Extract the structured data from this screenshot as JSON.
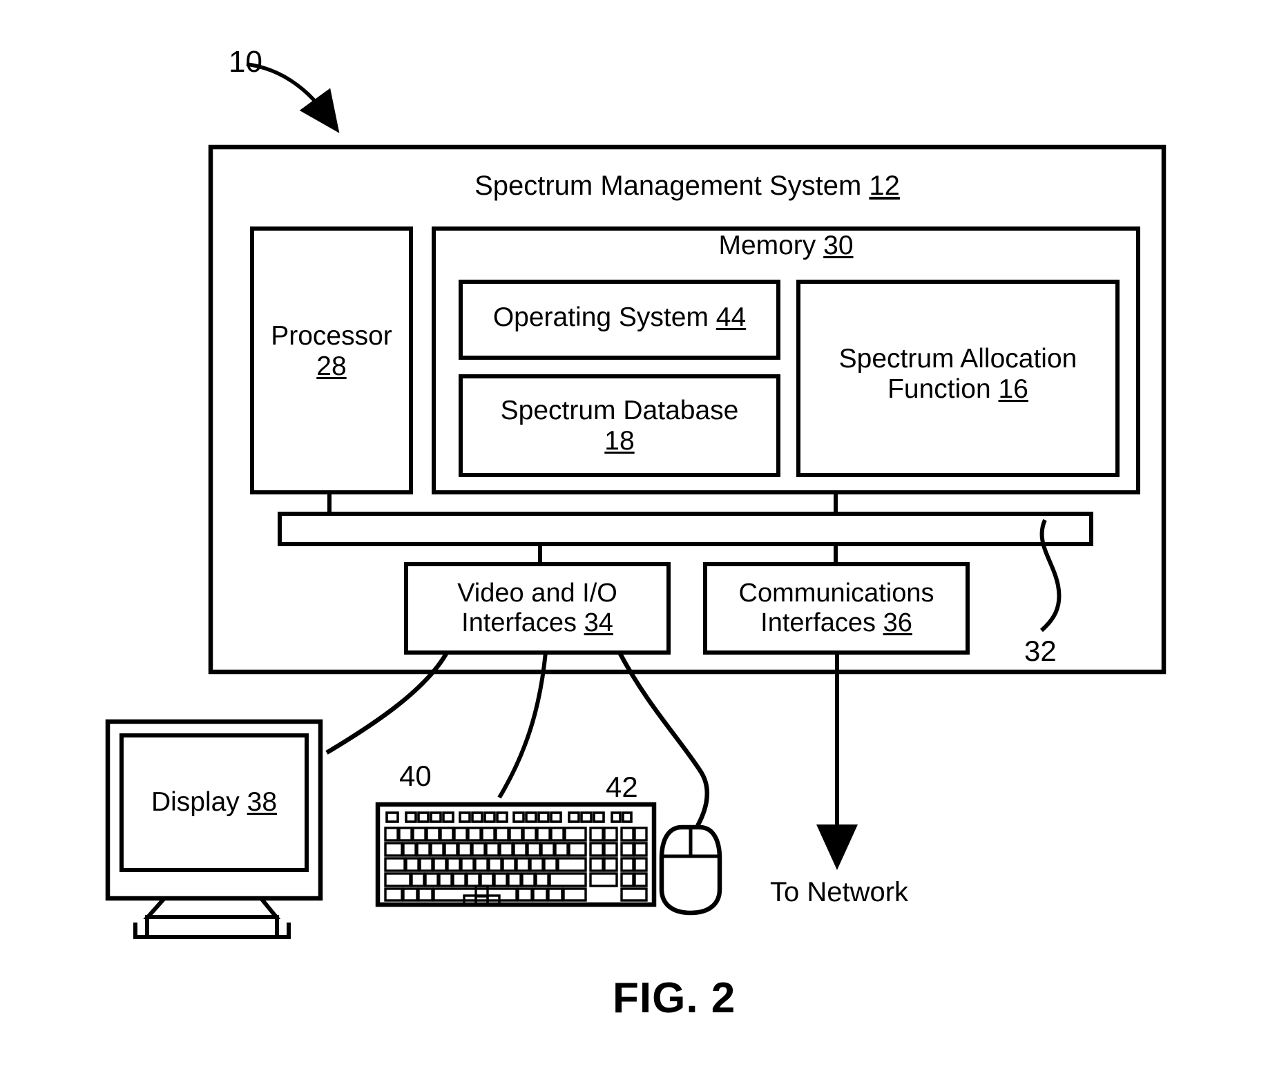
{
  "figure": {
    "caption": "FIG. 2",
    "top_reference": "10"
  },
  "system": {
    "title": "Spectrum Management System",
    "title_ref": "12"
  },
  "processor": {
    "label": "Processor",
    "ref": "28"
  },
  "memory": {
    "title": "Memory",
    "title_ref": "30",
    "blocks": [
      {
        "label": "Operating System",
        "ref": "44"
      },
      {
        "label": "Spectrum Database",
        "ref": "18"
      },
      {
        "label_line1": "Spectrum Allocation",
        "label_line2": "Function",
        "ref": "16"
      }
    ]
  },
  "bus": {
    "ref": "32"
  },
  "interfaces": [
    {
      "line1": "Video and I/O",
      "line2": "Interfaces",
      "ref": "34"
    },
    {
      "line1": "Communications",
      "line2": "Interfaces",
      "ref": "36"
    }
  ],
  "peripherals": {
    "display": {
      "label": "Display",
      "ref": "38"
    },
    "keyboard": {
      "ref": "40"
    },
    "mouse": {
      "ref": "42"
    },
    "network": {
      "label": "To Network"
    }
  },
  "colors": {
    "stroke": "#000000",
    "background": "#ffffff"
  }
}
